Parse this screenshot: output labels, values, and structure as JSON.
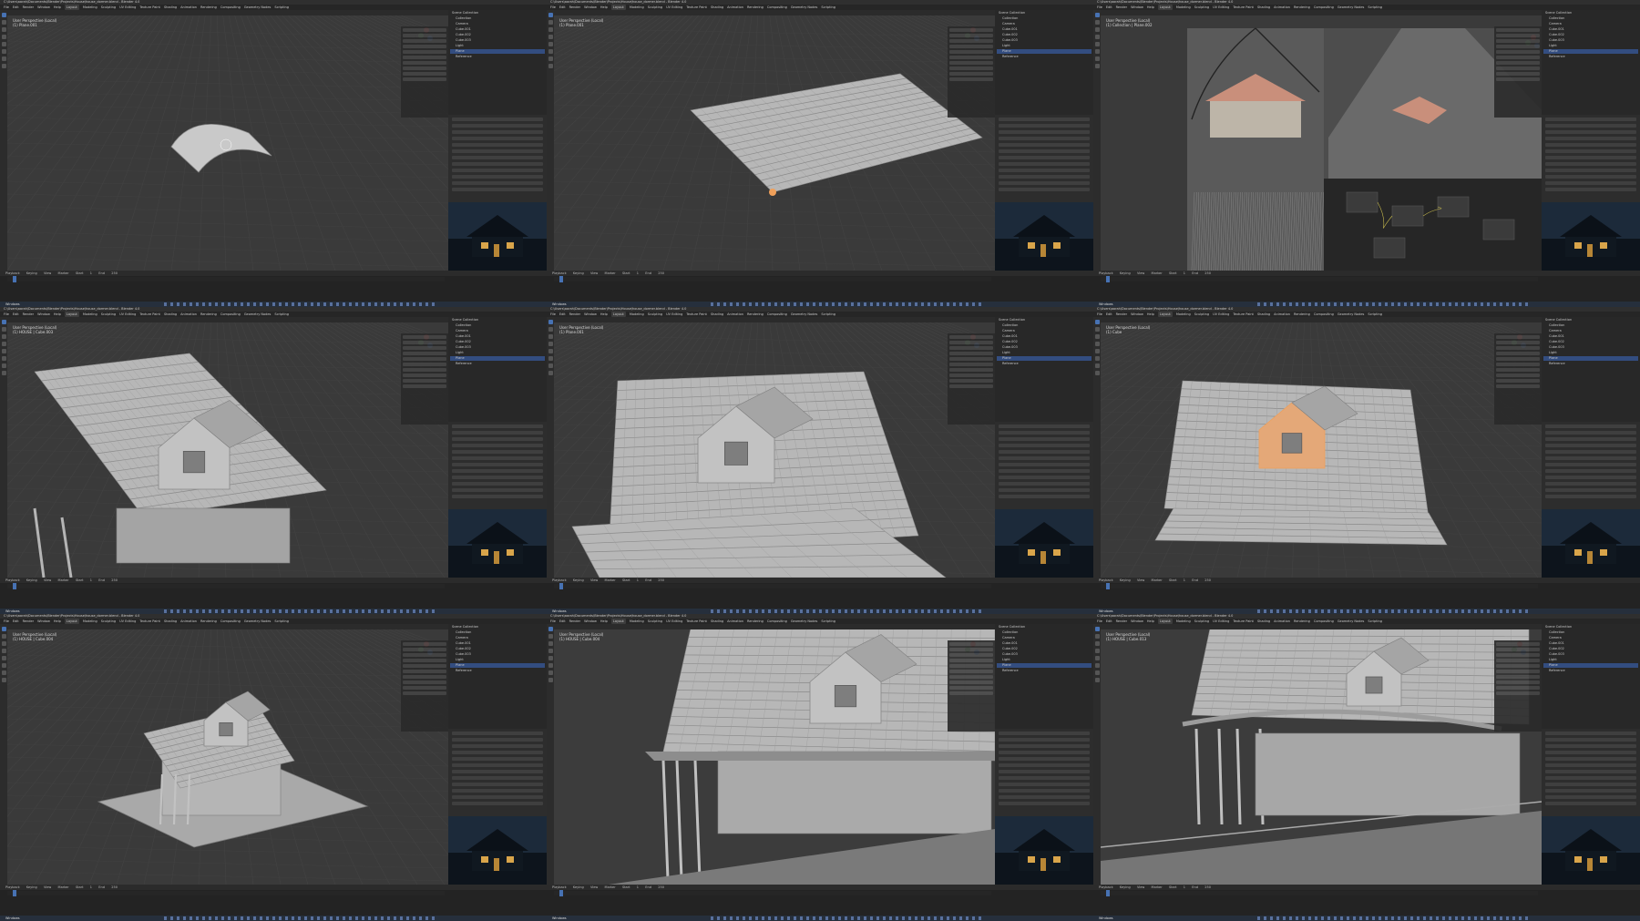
{
  "window_title": "C:\\Users\\aarah\\Documents\\Blender\\Projects\\House\\house_dormer.blend - Blender 4.0",
  "menus": [
    "File",
    "Edit",
    "Render",
    "Window",
    "Help",
    "Layout",
    "Modeling",
    "Sculpting",
    "UV Editing",
    "Texture Paint",
    "Shading",
    "Animation",
    "Rendering",
    "Compositing",
    "Geometry Nodes",
    "Scripting"
  ],
  "active_workspace": "Layout",
  "viewport_info_line1": "User Perspective (Local)",
  "outliner_items": [
    "Scene Collection",
    "Collection",
    "Camera",
    "Cube.001",
    "Cube.002",
    "Cube.003",
    "Light",
    "Plane",
    "Reference"
  ],
  "selected_item": "Plane",
  "timeline": {
    "labels": [
      "Playback",
      "Keying",
      "View",
      "Marker"
    ],
    "start_label": "Start",
    "start": "1",
    "end_label": "End",
    "end": "250",
    "frame": "1"
  },
  "taskbar_label": "Windows",
  "panels": [
    {
      "id": "p1",
      "object": "(1) Plane.001"
    },
    {
      "id": "p2",
      "object": "(1) Plane.001"
    },
    {
      "id": "p3",
      "object": "(1) Collection | Plane.002"
    },
    {
      "id": "p4",
      "object": "(1) HOUSE | Cube.003"
    },
    {
      "id": "p5",
      "object": "(1) Plane.001"
    },
    {
      "id": "p6",
      "object": "(1) Cube"
    },
    {
      "id": "p7",
      "object": "(1) HOUSE | Cube.004"
    },
    {
      "id": "p8",
      "object": "(1) HOUSE | Cube.004"
    },
    {
      "id": "p9",
      "object": "(1) HOUSE | Cube.013"
    }
  ],
  "colors": {
    "accent": "#4772b3",
    "selection": "#f0a05a",
    "viewport": "#3a3a3a",
    "model": "#bdbdbd"
  },
  "icons": [
    "move-tool-icon",
    "rotate-tool-icon",
    "scale-tool-icon",
    "navigation-gizmo-icon",
    "eye-icon",
    "camera-icon"
  ]
}
